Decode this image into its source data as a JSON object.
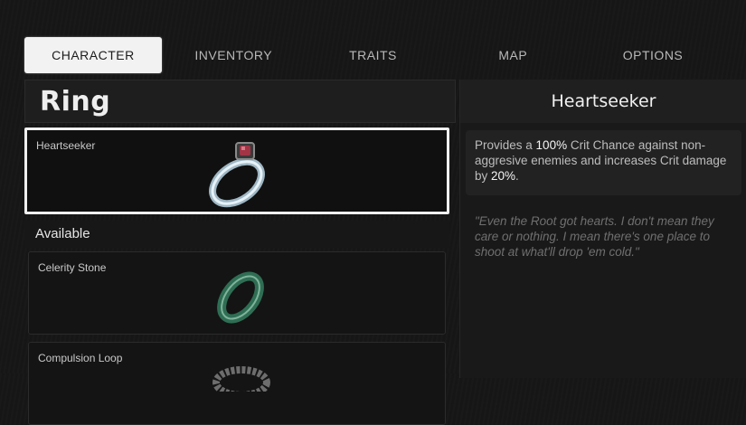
{
  "tabs": [
    {
      "label": "CHARACTER",
      "active": true
    },
    {
      "label": "INVENTORY",
      "active": false
    },
    {
      "label": "TRAITS",
      "active": false
    },
    {
      "label": "MAP",
      "active": false
    },
    {
      "label": "OPTIONS",
      "active": false
    }
  ],
  "category": {
    "title": "Ring"
  },
  "equipped": {
    "name": "Heartseeker",
    "icon": "silver-ring-red-gem-icon"
  },
  "available": {
    "label": "Available",
    "items": [
      {
        "name": "Celerity Stone",
        "icon": "green-band-ring-icon"
      },
      {
        "name": "Compulsion Loop",
        "icon": "twisted-metal-ring-icon"
      }
    ]
  },
  "details": {
    "title": "Heartseeker",
    "desc_prefix": "Provides a ",
    "desc_value1": "100%",
    "desc_mid": " Crit Chance against non-aggresive enemies and increases Crit damage by ",
    "desc_value2": "20%",
    "desc_suffix": ".",
    "flavor": "\"Even the Root got hearts. I don't mean they care or nothing. I mean there's one place to shoot at what'll drop 'em cold.\""
  },
  "colors": {
    "highlight": "#f0f0f0",
    "background": "#161616"
  }
}
